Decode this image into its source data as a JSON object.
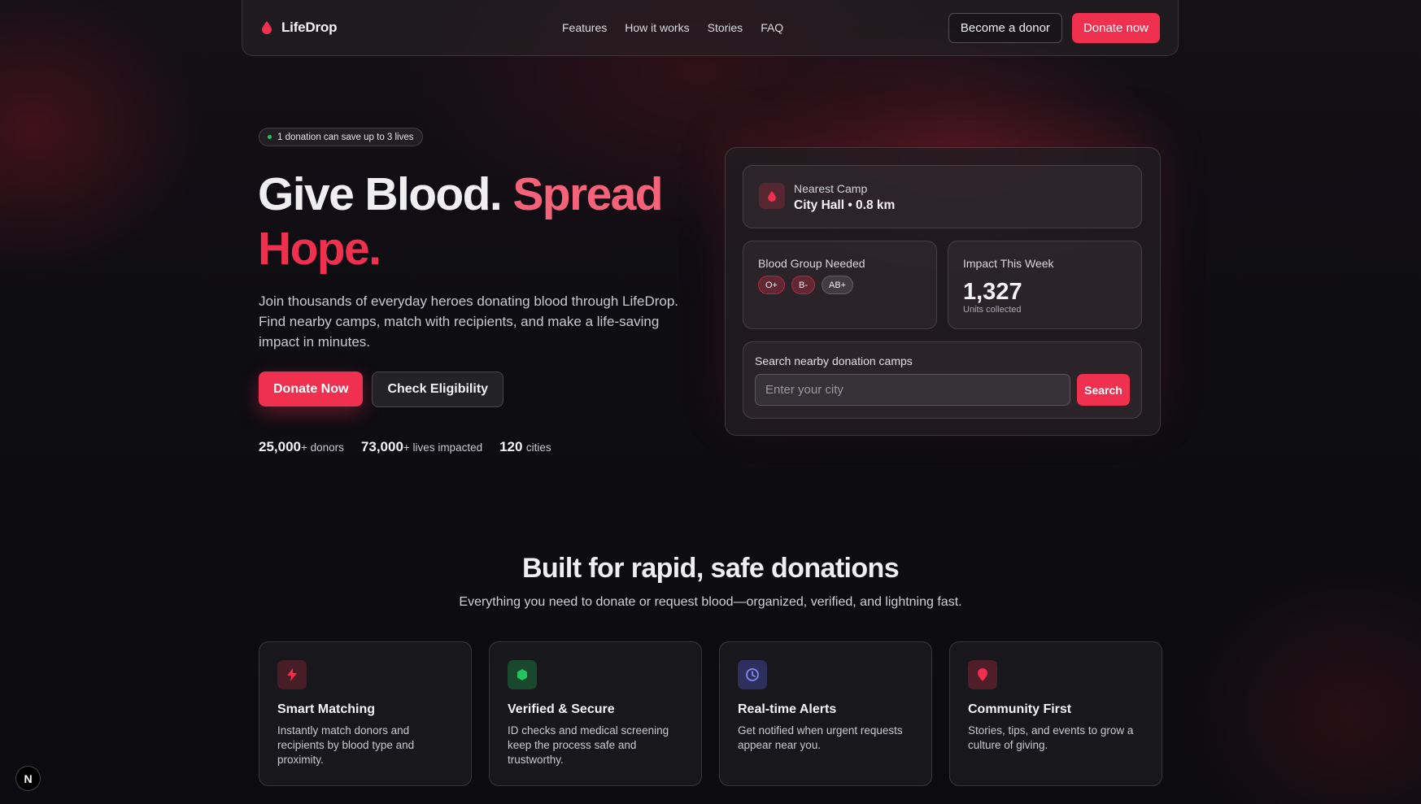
{
  "nav": {
    "brand": "LifeDrop",
    "links": [
      "Features",
      "How it works",
      "Stories",
      "FAQ"
    ],
    "become_donor": "Become a donor",
    "donate_now": "Donate now"
  },
  "hero": {
    "pill": "1 donation can save up to 3 lives",
    "title_part1": "Give Blood.",
    "title_part2": "Spread",
    "title_part3": "Hope",
    "title_dot": ".",
    "description": "Join thousands of everyday heroes donating blood through LifeDrop. Find nearby camps, match with recipients, and make a life-saving impact in minutes.",
    "btn_donate": "Donate Now",
    "btn_check": "Check Eligibility",
    "stats": [
      {
        "value": "25,000",
        "label": "+ donors"
      },
      {
        "value": "73,000",
        "label": "+ lives impacted"
      },
      {
        "value": "120",
        "label": "cities"
      }
    ]
  },
  "panel": {
    "camp_label": "Nearest Camp",
    "camp_value": "City Hall • 0.8 km",
    "blood_group_label": "Blood Group Needed",
    "blood_groups": [
      "O+",
      "B-",
      "AB+"
    ],
    "impact_label": "Impact This Week",
    "impact_value": "1,327",
    "impact_sub": "Units collected",
    "search_label": "Search nearby donation camps",
    "search_placeholder": "Enter your city",
    "search_btn": "Search"
  },
  "features": {
    "title": "Built for rapid, safe donations",
    "subtitle": "Everything you need to donate or request blood—organized, verified, and lightning fast.",
    "items": [
      {
        "name": "Smart Matching",
        "desc": "Instantly match donors and recipients by blood type and proximity.",
        "icon": "bolt-icon"
      },
      {
        "name": "Verified & Secure",
        "desc": "ID checks and medical screening keep the process safe and trustworthy.",
        "icon": "shield-icon"
      },
      {
        "name": "Real-time Alerts",
        "desc": "Get notified when urgent requests appear near you.",
        "icon": "clock-icon"
      },
      {
        "name": "Community First",
        "desc": "Stories, tips, and events to grow a culture of giving.",
        "icon": "map-pin-icon"
      }
    ]
  },
  "badge": "N",
  "colors": {
    "accent": "#f0304f",
    "background": "#0d0d11"
  }
}
